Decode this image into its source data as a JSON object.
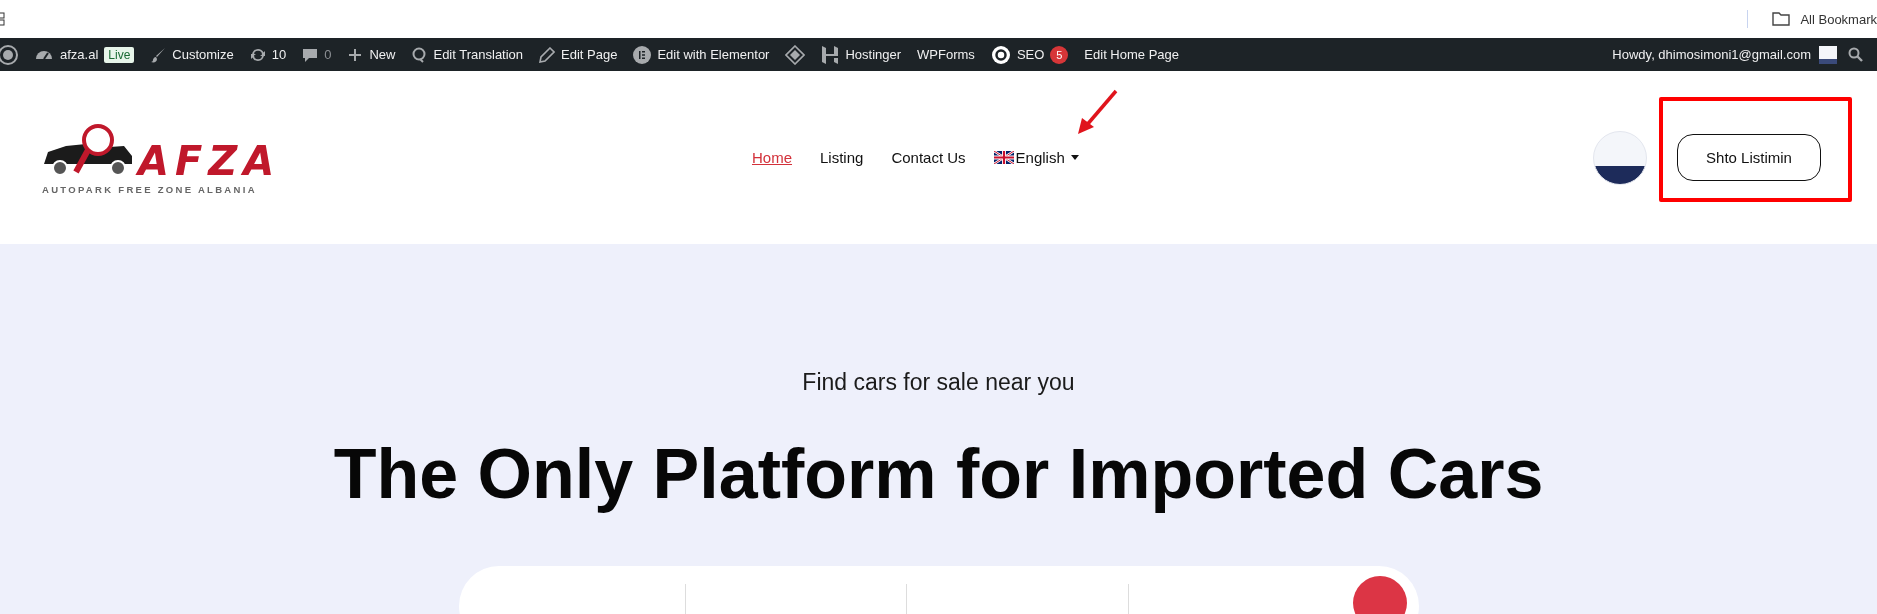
{
  "browser_bar": {
    "bookmarks_label": "All Bookmark"
  },
  "admin_bar": {
    "items": [
      {
        "kind": "wordpress"
      },
      {
        "kind": "site",
        "label": "afza.al",
        "badge": "Live"
      },
      {
        "kind": "customize",
        "label": "Customize"
      },
      {
        "kind": "updates",
        "label": "10"
      },
      {
        "kind": "comments",
        "label": "0"
      },
      {
        "kind": "new",
        "label": "New"
      },
      {
        "kind": "translate",
        "label": "Edit Translation"
      },
      {
        "kind": "edit",
        "label": "Edit Page"
      },
      {
        "kind": "elementor",
        "label": "Edit with Elementor"
      },
      {
        "kind": "diamond"
      },
      {
        "kind": "hostinger",
        "label": "Hostinger"
      },
      {
        "kind": "plain",
        "label": "WPForms"
      },
      {
        "kind": "seo",
        "label": "SEO",
        "count": "5"
      },
      {
        "kind": "plain",
        "label": "Edit Home Page"
      }
    ],
    "greeting": "Howdy, dhimosimoni1@gmail.com"
  },
  "header": {
    "logo": {
      "title": "AFZA",
      "subtitle": "AUTOPARK FREE ZONE ALBANIA"
    },
    "nav": [
      {
        "label": "Home",
        "selected": true,
        "kind": "link"
      },
      {
        "label": "Listing",
        "selected": false,
        "kind": "link"
      },
      {
        "label": "Contact Us",
        "selected": false,
        "kind": "link"
      },
      {
        "label": "English",
        "selected": false,
        "kind": "language"
      }
    ],
    "button": "Shto Listimin"
  },
  "hero": {
    "tagline": "Find cars for sale near you",
    "title": "The Only Platform for Imported Cars"
  }
}
